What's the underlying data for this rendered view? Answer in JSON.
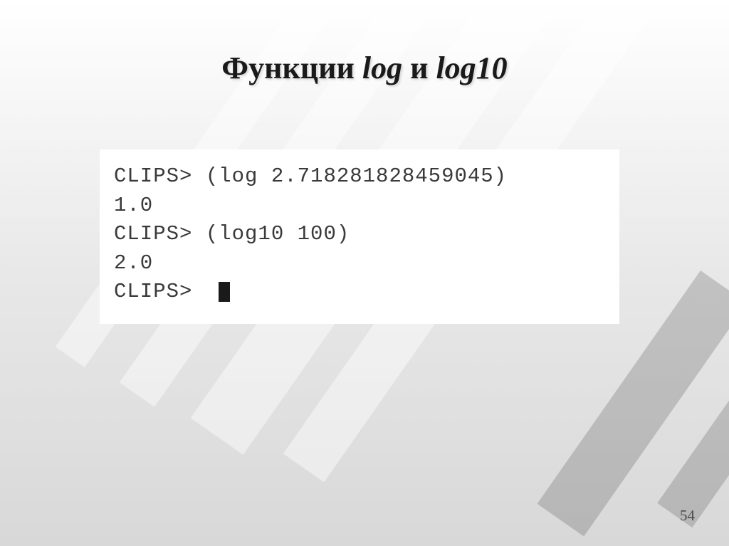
{
  "title": {
    "prefix": "Функции ",
    "term1": "log",
    "middle": " и ",
    "term2": "log10"
  },
  "code": {
    "line1": "CLIPS> (log 2.718281828459045)",
    "line2": "1.0",
    "line3": "CLIPS> (log10 100)",
    "line4": "2.0",
    "line5": "CLIPS>  "
  },
  "page_number": "54"
}
